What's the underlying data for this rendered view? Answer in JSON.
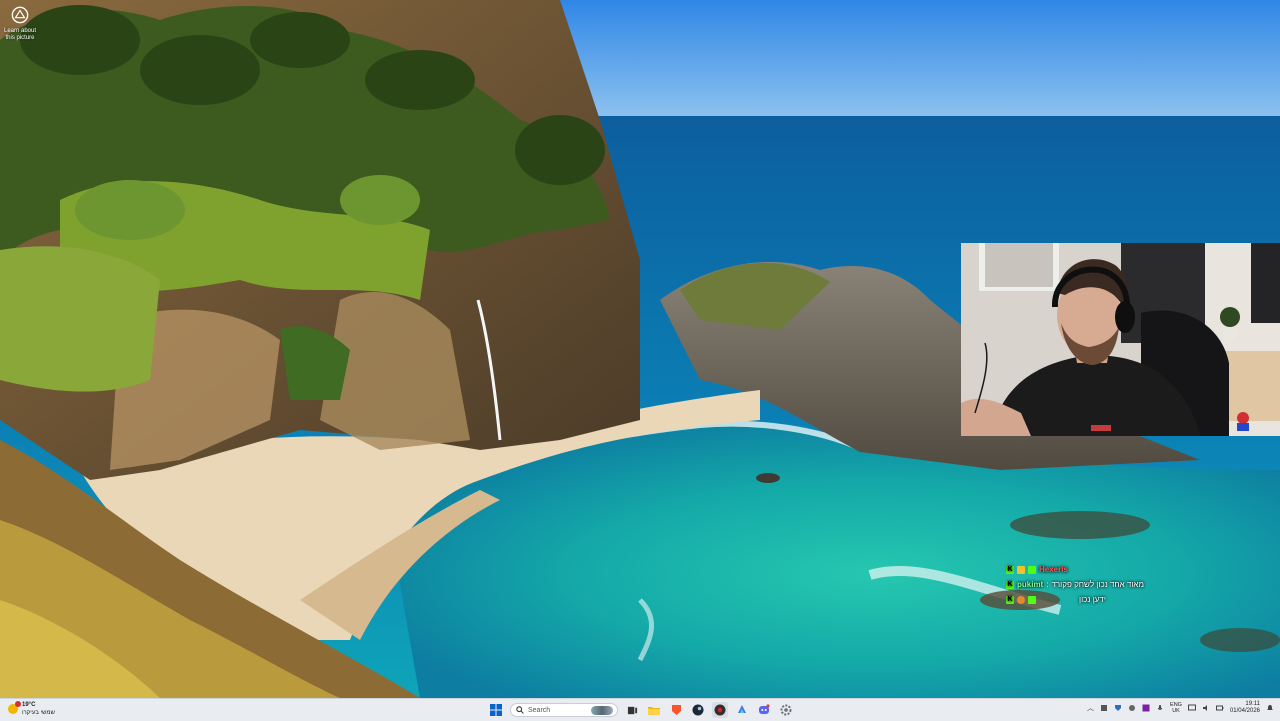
{
  "desktop": {
    "learn_icon": {
      "label_line1": "Learn about",
      "label_line2": "this picture",
      "icon": "camera-info-icon"
    }
  },
  "chat": {
    "messages": [
      {
        "badges": [
          "K",
          "yellow",
          "green"
        ],
        "user": "Hexeris",
        "user_color": "#ff5a5a",
        "text": ""
      },
      {
        "badges": [
          "K"
        ],
        "user": "pukimt",
        "user_color": "#7cff9a",
        "text": "מאוד אחד נכון לשחק פקורד"
      },
      {
        "badges": [
          "K",
          "orange"
        ],
        "user": "",
        "user_color": "#7cff9a",
        "text": "ידען נכון"
      }
    ]
  },
  "taskbar": {
    "weather": {
      "temp": "19°C",
      "condition": "שמשי בעיקרו",
      "icon": "sun-alert-icon"
    },
    "start_icon": "windows-start-icon",
    "search": {
      "placeholder": "Search",
      "icon": "search-icon"
    },
    "pinned": [
      {
        "name": "task-view-icon",
        "color": "#333333"
      },
      {
        "name": "file-explorer-icon",
        "color": "#f2b900"
      },
      {
        "name": "brave-browser-icon",
        "color": "#fb542b"
      },
      {
        "name": "steam-icon",
        "color": "#1b2838"
      },
      {
        "name": "obs-icon",
        "color": "#302e31"
      },
      {
        "name": "copilot-icon",
        "color": "#3b7fdc"
      },
      {
        "name": "discord-icon",
        "color": "#5865f2"
      },
      {
        "name": "settings-icon",
        "color": "#6b6f77"
      }
    ],
    "tray": {
      "language_top": "ENG",
      "language_bottom": "UK",
      "time": "19:11",
      "date": "01/04/2026"
    }
  }
}
